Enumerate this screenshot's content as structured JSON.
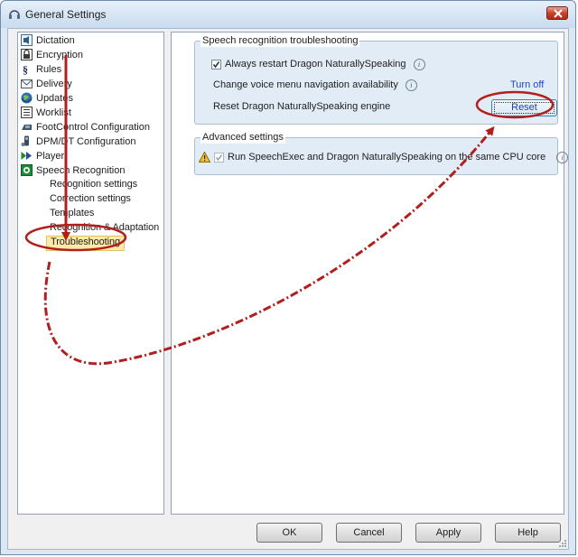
{
  "window": {
    "title": "General Settings",
    "close_label": "Close"
  },
  "tree": {
    "items": [
      {
        "label": "Dictation",
        "icon": "dictation-icon"
      },
      {
        "label": "Encryption",
        "icon": "lock-icon"
      },
      {
        "label": "Rules",
        "icon": "paragraph-icon"
      },
      {
        "label": "Delivery",
        "icon": "mail-icon"
      },
      {
        "label": "Updates",
        "icon": "globe-icon"
      },
      {
        "label": "Worklist",
        "icon": "list-icon"
      },
      {
        "label": "FootControl Configuration",
        "icon": "foot-control-icon"
      },
      {
        "label": "DPM/DT Configuration",
        "icon": "recorder-icon"
      },
      {
        "label": "Player",
        "icon": "player-icon"
      },
      {
        "label": "Speech Recognition",
        "icon": "speech-icon"
      }
    ],
    "sub_items": [
      {
        "label": "Recognition settings"
      },
      {
        "label": "Correction settings"
      },
      {
        "label": "Templates"
      },
      {
        "label": "Recognition & Adaptation"
      },
      {
        "label": "Troubleshooting",
        "selected": true
      }
    ]
  },
  "troubleshooting": {
    "group_title": "Speech recognition troubleshooting",
    "always_restart_label": "Always restart Dragon NaturallySpeaking",
    "always_restart_checked": true,
    "voice_menu_label": "Change voice menu navigation availability",
    "turn_off_link": "Turn off",
    "reset_engine_label": "Reset Dragon NaturallySpeaking engine",
    "reset_button": "Reset"
  },
  "advanced": {
    "group_title": "Advanced settings",
    "same_cpu_label": "Run SpeechExec and Dragon NaturallySpeaking on the same CPU core",
    "same_cpu_checked": true,
    "same_cpu_disabled": true
  },
  "footer": {
    "ok": "OK",
    "cancel": "Cancel",
    "apply": "Apply",
    "help": "Help"
  },
  "colors": {
    "annotation_red": "#b01e1e",
    "selection_highlight": "#fde9a8",
    "link_blue": "#1a49c9"
  }
}
